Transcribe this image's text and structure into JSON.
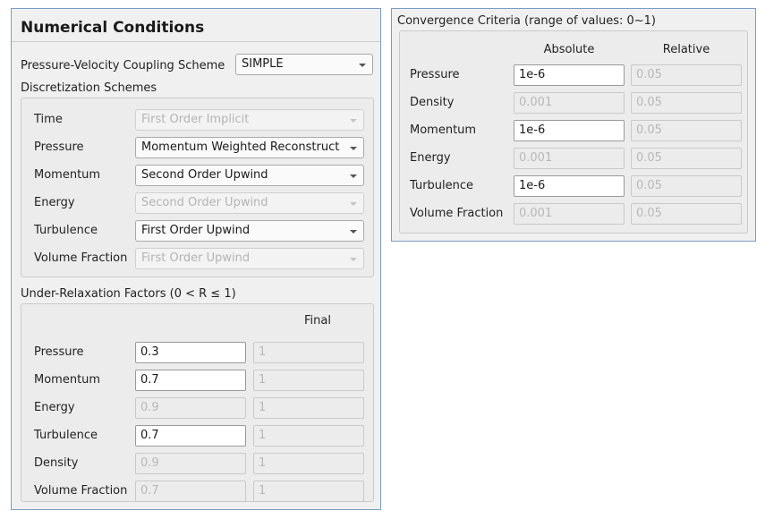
{
  "numerical": {
    "title": "Numerical Conditions",
    "coupling": {
      "label": "Pressure-Velocity Coupling Scheme",
      "value": "SIMPLE"
    },
    "discretization": {
      "label": "Discretization Schemes",
      "rows": [
        {
          "label": "Time",
          "value": "First Order Implicit",
          "enabled": false
        },
        {
          "label": "Pressure",
          "value": "Momentum Weighted Reconstruct",
          "enabled": true
        },
        {
          "label": "Momentum",
          "value": "Second Order Upwind",
          "enabled": true
        },
        {
          "label": "Energy",
          "value": "Second Order Upwind",
          "enabled": false
        },
        {
          "label": "Turbulence",
          "value": "First Order Upwind",
          "enabled": true
        },
        {
          "label": "Volume Fraction",
          "value": "First Order Upwind",
          "enabled": false
        }
      ]
    },
    "relaxation": {
      "label": "Under-Relaxation Factors (0 < R ≤ 1)",
      "final_header": "Final",
      "rows": [
        {
          "label": "Pressure",
          "value": "0.3",
          "enabled": true,
          "final": "1"
        },
        {
          "label": "Momentum",
          "value": "0.7",
          "enabled": true,
          "final": "1"
        },
        {
          "label": "Energy",
          "value": "0.9",
          "enabled": false,
          "final": "1"
        },
        {
          "label": "Turbulence",
          "value": "0.7",
          "enabled": true,
          "final": "1"
        },
        {
          "label": "Density",
          "value": "0.9",
          "enabled": false,
          "final": "1"
        },
        {
          "label": "Volume Fraction",
          "value": "0.7",
          "enabled": false,
          "final": "1"
        }
      ]
    }
  },
  "convergence": {
    "title": "Convergence Criteria (range of values: 0~1)",
    "absolute_header": "Absolute",
    "relative_header": "Relative",
    "rows": [
      {
        "label": "Pressure",
        "absolute": "1e-6",
        "abs_enabled": true,
        "relative": "0.05"
      },
      {
        "label": "Density",
        "absolute": "0.001",
        "abs_enabled": false,
        "relative": "0.05"
      },
      {
        "label": "Momentum",
        "absolute": "1e-6",
        "abs_enabled": true,
        "relative": "0.05"
      },
      {
        "label": "Energy",
        "absolute": "0.001",
        "abs_enabled": false,
        "relative": "0.05"
      },
      {
        "label": "Turbulence",
        "absolute": "1e-6",
        "abs_enabled": true,
        "relative": "0.05"
      },
      {
        "label": "Volume Fraction",
        "absolute": "0.001",
        "abs_enabled": false,
        "relative": "0.05"
      }
    ]
  }
}
